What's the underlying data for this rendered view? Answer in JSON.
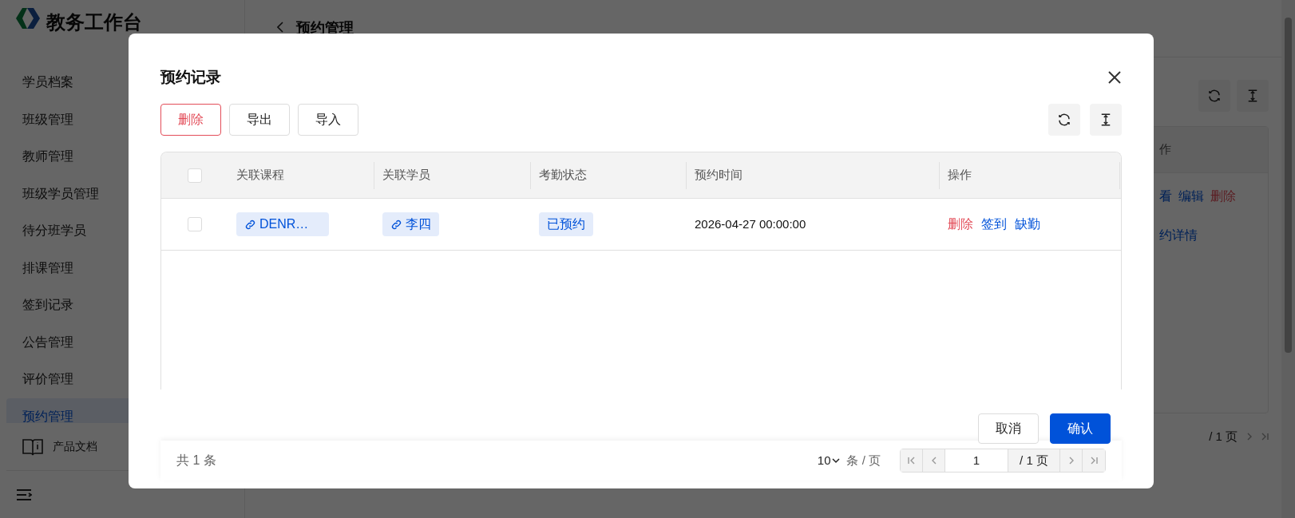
{
  "sidebar": {
    "title": "教务工作台",
    "items": [
      {
        "label": "学员档案",
        "selected": false
      },
      {
        "label": "班级管理",
        "selected": false
      },
      {
        "label": "教师管理",
        "selected": false
      },
      {
        "label": "班级学员管理",
        "selected": false
      },
      {
        "label": "待分班学员",
        "selected": false
      },
      {
        "label": "排课管理",
        "selected": false
      },
      {
        "label": "签到记录",
        "selected": false
      },
      {
        "label": "公告管理",
        "selected": false
      },
      {
        "label": "评价管理",
        "selected": false
      },
      {
        "label": "预约管理",
        "selected": true
      }
    ],
    "docs_link": "产品文档"
  },
  "page": {
    "title": "预约管理",
    "column_fragment": "作",
    "row_actions": [
      {
        "label": "看",
        "kind": "link"
      },
      {
        "label": "编辑",
        "kind": "link"
      },
      {
        "label": "删除",
        "kind": "danger"
      }
    ],
    "row_fragment": "约详情",
    "page_count": "/ 1 页"
  },
  "dialog": {
    "title": "预约记录",
    "toolbar": [
      {
        "label": "删除",
        "kind": "danger"
      },
      {
        "label": "导出",
        "kind": "default"
      },
      {
        "label": "导入",
        "kind": "default"
      }
    ],
    "table": {
      "header_checked": false,
      "columns": [
        "关联课程",
        "关联学员",
        "考勤状态",
        "预约时间",
        "操作"
      ],
      "rows": [
        {
          "checked": false,
          "course": "DENR…",
          "student": "李四",
          "status": "已预约",
          "time": "2026-04-27 00:00:00",
          "actions": [
            {
              "label": "删除",
              "kind": "danger"
            },
            {
              "label": "签到",
              "kind": "link"
            },
            {
              "label": "缺勤",
              "kind": "link"
            }
          ]
        }
      ]
    },
    "footer_buttons": [
      {
        "label": "取消",
        "kind": "default"
      },
      {
        "label": "确认",
        "kind": "primary"
      }
    ],
    "pagination": {
      "total": "共 1 条",
      "page_size": "10",
      "page_size_unit": "条 / 页",
      "page": "1",
      "page_count": "/ 1 页"
    }
  }
}
